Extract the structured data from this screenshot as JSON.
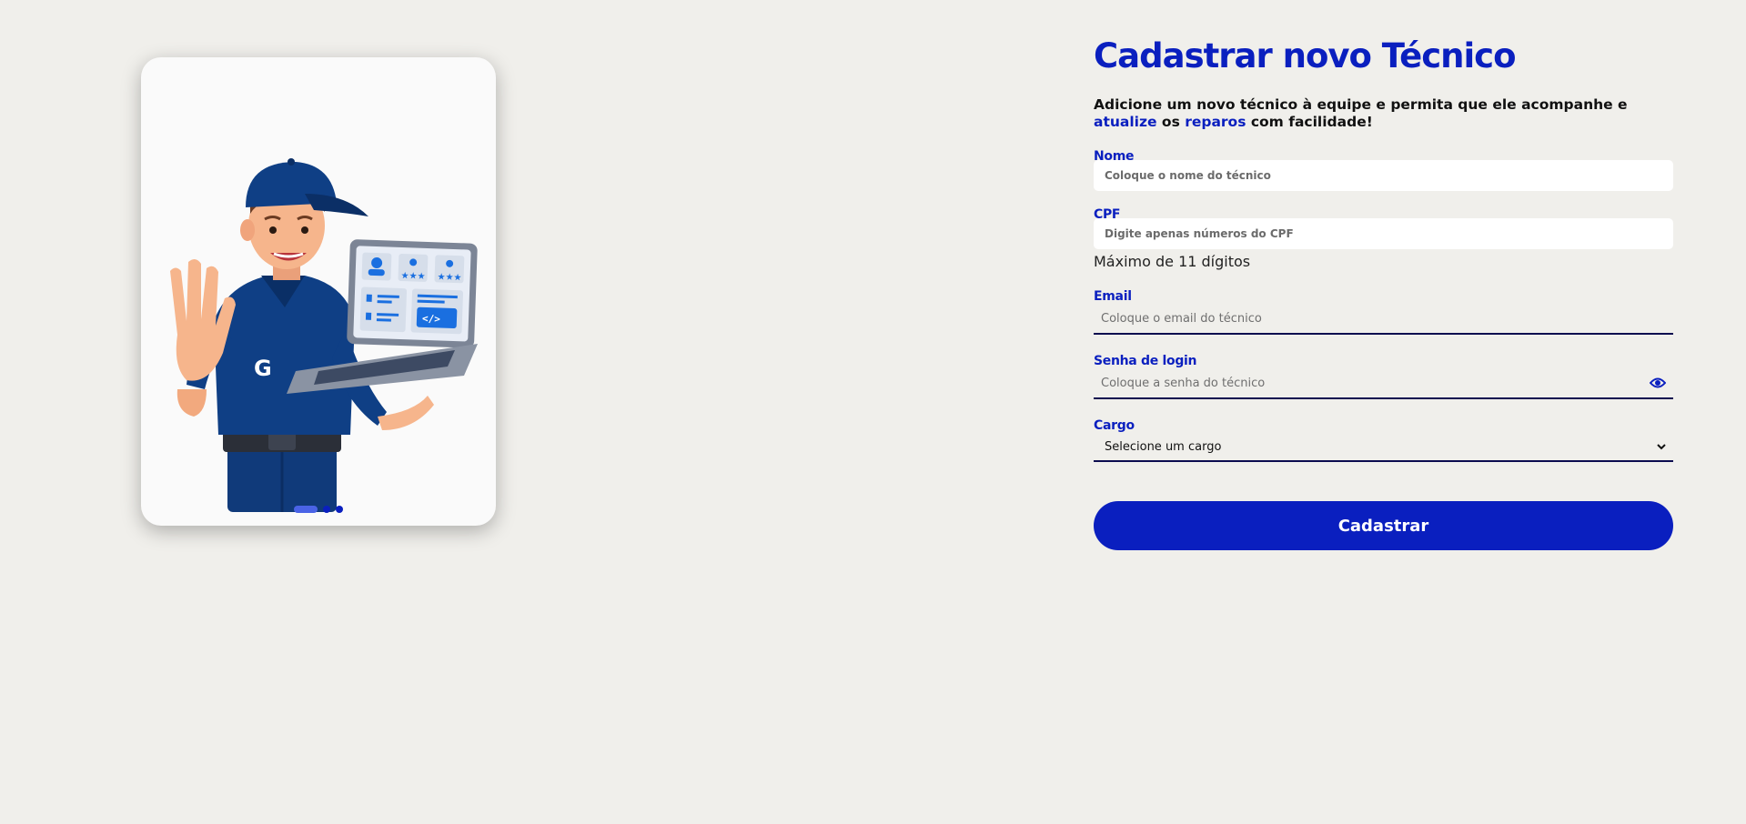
{
  "carousel": {
    "slides": 3,
    "active_slide": 1,
    "illustration": "technician-with-laptop",
    "badge_letter": "G"
  },
  "form": {
    "title": "Cadastrar novo Técnico",
    "subtitle": {
      "part1": "Adicione um novo técnico à equipe e permita que ele acompanhe e ",
      "highlight1": "atualize",
      "part2": " os ",
      "highlight2": "reparos",
      "part3": " com facilidade!"
    },
    "nome": {
      "label": "Nome",
      "placeholder": "Coloque o nome do técnico",
      "value": ""
    },
    "cpf": {
      "label": "CPF",
      "placeholder": "Digite apenas números do CPF",
      "value": "",
      "hint": "Máximo de 11 dígitos"
    },
    "email": {
      "label": "Email",
      "placeholder": "Coloque o email do técnico",
      "value": ""
    },
    "senha": {
      "label": "Senha de login",
      "placeholder": "Coloque a senha do técnico",
      "value": "",
      "toggle_icon": "eye-icon"
    },
    "cargo": {
      "label": "Cargo",
      "selected": "Selecione um cargo"
    },
    "submit_label": "Cadastrar"
  },
  "colors": {
    "background": "#f0efeb",
    "accent": "#0a1fbf",
    "underline": "#0b0b4f",
    "dot_active": "#4a63e6"
  }
}
